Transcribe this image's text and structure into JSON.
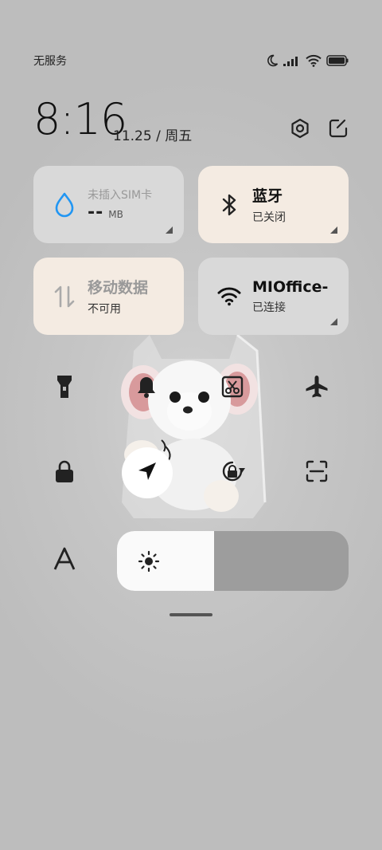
{
  "status_bar": {
    "carrier": "无服务",
    "icons": [
      "moon-icon",
      "signal-icon",
      "wifi-icon",
      "battery-icon"
    ]
  },
  "header": {
    "time": "8:16",
    "date": "11.25 / 周五",
    "icons": [
      "settings-icon",
      "edit-icon"
    ]
  },
  "tiles": {
    "data": {
      "title": "未插入SIM卡",
      "value": "--",
      "unit": "MB",
      "icon": "water-drop-icon"
    },
    "bluetooth": {
      "title": "蓝牙",
      "status": "已关闭",
      "icon": "bluetooth-icon"
    },
    "mobile": {
      "title": "移动数据",
      "status": "不可用",
      "icon": "arrows-updown-icon"
    },
    "wifi": {
      "title": "MIOffice-",
      "status": "已连接",
      "icon": "wifi-icon"
    }
  },
  "toggles": [
    {
      "name": "flashlight",
      "icon": "flashlight-icon",
      "active": false
    },
    {
      "name": "ringer",
      "icon": "bell-icon",
      "active": false
    },
    {
      "name": "screenshot",
      "icon": "scissors-icon",
      "active": false
    },
    {
      "name": "airplane",
      "icon": "airplane-icon",
      "active": false
    },
    {
      "name": "lock",
      "icon": "lock-icon",
      "active": false
    },
    {
      "name": "location",
      "icon": "location-arrow-icon",
      "active": true
    },
    {
      "name": "rotation-lock",
      "icon": "rotation-lock-icon",
      "active": false
    },
    {
      "name": "scan",
      "icon": "scan-icon",
      "active": false
    },
    {
      "name": "font",
      "icon": "font-icon",
      "active": false
    }
  ],
  "brightness": {
    "level": 0.42,
    "icon": "sun-icon"
  },
  "colors": {
    "tile_grey": "#d9d9d9",
    "tile_beige": "#f4ebe2",
    "accent_blue": "#2196f3"
  }
}
